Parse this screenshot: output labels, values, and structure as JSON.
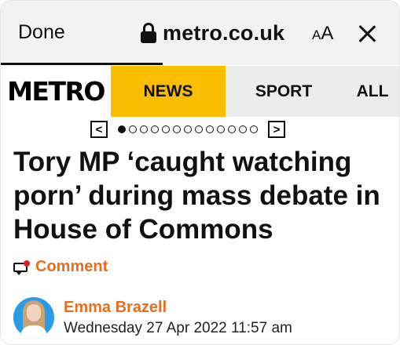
{
  "browser": {
    "done_label": "Done",
    "url": "metro.co.uk",
    "text_size_label_small": "A",
    "text_size_label_large": "A",
    "lock_icon": "lock-icon",
    "close_icon": "close-icon"
  },
  "nav": {
    "logo_text": "METRO",
    "items": [
      {
        "label": "NEWS",
        "active": true,
        "color": "#fbbd00"
      },
      {
        "label": "SPORT",
        "active": false
      },
      {
        "label": "ALL",
        "active": false
      }
    ]
  },
  "pager": {
    "prev_symbol": "<",
    "next_symbol": ">",
    "total_dots": 13,
    "active_index": 0
  },
  "article": {
    "headline": "Tory MP ‘caught watching porn’ during mass debate in House of Commons",
    "comment_label": "Comment",
    "author": "Emma Brazell",
    "date": "Wednesday 27 Apr 2022 11:57 am"
  },
  "colors": {
    "accent_orange": "#e76d1f",
    "news_yellow": "#fbbd00",
    "notification_red": "#e0201b"
  }
}
